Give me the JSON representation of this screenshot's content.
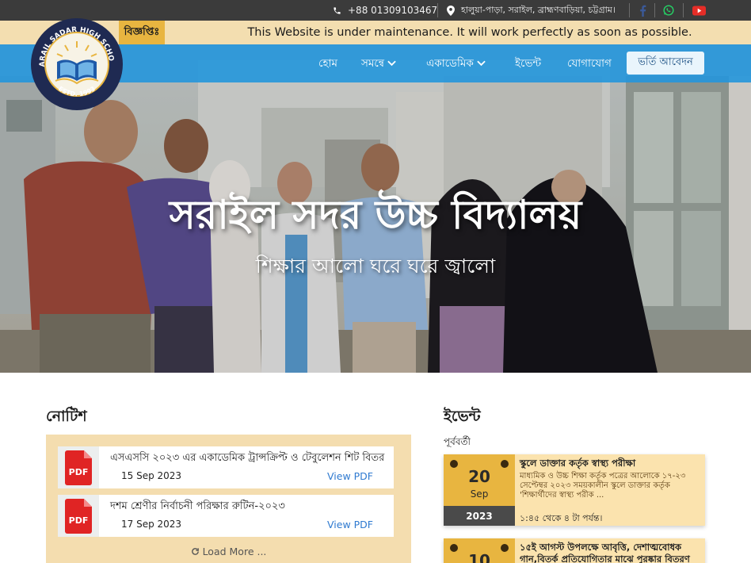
{
  "topbar": {
    "phone": "+88 01309103467",
    "address": "হালুয়া-পাড়া, সরাইল, ব্রাহ্মণবাড়িয়া, চট্টগ্রাম।",
    "icons": [
      "phone-icon",
      "location-icon",
      "facebook-icon",
      "whatsapp-icon",
      "youtube-icon"
    ],
    "colors": {
      "facebook": "#3b5998",
      "whatsapp": "#25d366",
      "youtube": "#e52d27"
    }
  },
  "logo": {
    "text_top": "SARAIL SADAR HIGH SCHOOL",
    "text_bottom": "ESTD. 1993"
  },
  "notice_bar": {
    "label": "বিজ্ঞপ্তিঃ",
    "message": "This Website is under maintenance. It will work perfectly as soon as possible."
  },
  "nav": {
    "items": [
      "হোম",
      "সমন্বে",
      "একাডেমিক",
      "ইভেন্ট",
      "যোগাযোগ"
    ],
    "apply_label": "ভর্তি আবেদন",
    "accent": "#2496dc"
  },
  "hero": {
    "title": "সরাইল সদর উচ্চ বিদ্যালয়",
    "subtitle": "শিক্ষার আলো ঘরে ঘরে জ্বালো"
  },
  "notices": {
    "heading": "নোটিশ",
    "items": [
      {
        "title": "এসএসসি ২০২৩ এর একাডেমিক ট্রান্সক্রিপ্ট ও টেবুলেশন শিট বিতর",
        "date": "15 Sep 2023",
        "link": "View PDF",
        "icon": "PDF"
      },
      {
        "title": "দশম শ্রেণীর নির্বাচনী পরিক্ষার রুটিন-২০২৩",
        "date": "17 Sep 2023",
        "link": "View PDF",
        "icon": "PDF"
      }
    ],
    "load_more": "Load More ..."
  },
  "events": {
    "heading": "ইভেন্ট",
    "previous_label": "পূর্ববর্তী",
    "items": [
      {
        "day": "20",
        "month": "Sep",
        "year": "2023",
        "title": "স্কুলে ডাক্তার কর্তৃক স্বাস্থ্য পরীক্ষা",
        "desc": "মাধ্যমিক ও উচ্চ শিক্ষা কর্তৃক পত্রের আলোকে ১৭-২৩ সেপ্টেম্বর ২০২৩ সময়কালীন স্কুলে ডাক্তার কর্তৃক 'শিক্ষার্থীদের স্বাস্থ্য পরীক ...",
        "time": "১:৪৫ থেকে ৪ টা পর্যন্ত।"
      },
      {
        "day": "10",
        "month": "",
        "year": "",
        "title": "১৫ই আগস্ট উপলক্ষে আবৃত্তি, দেশাত্মবোধক গান,বিতর্ক প্রতিযোগিতার মাঝে পুরষ্কার বিতরণ",
        "desc": "",
        "time": ""
      }
    ]
  }
}
